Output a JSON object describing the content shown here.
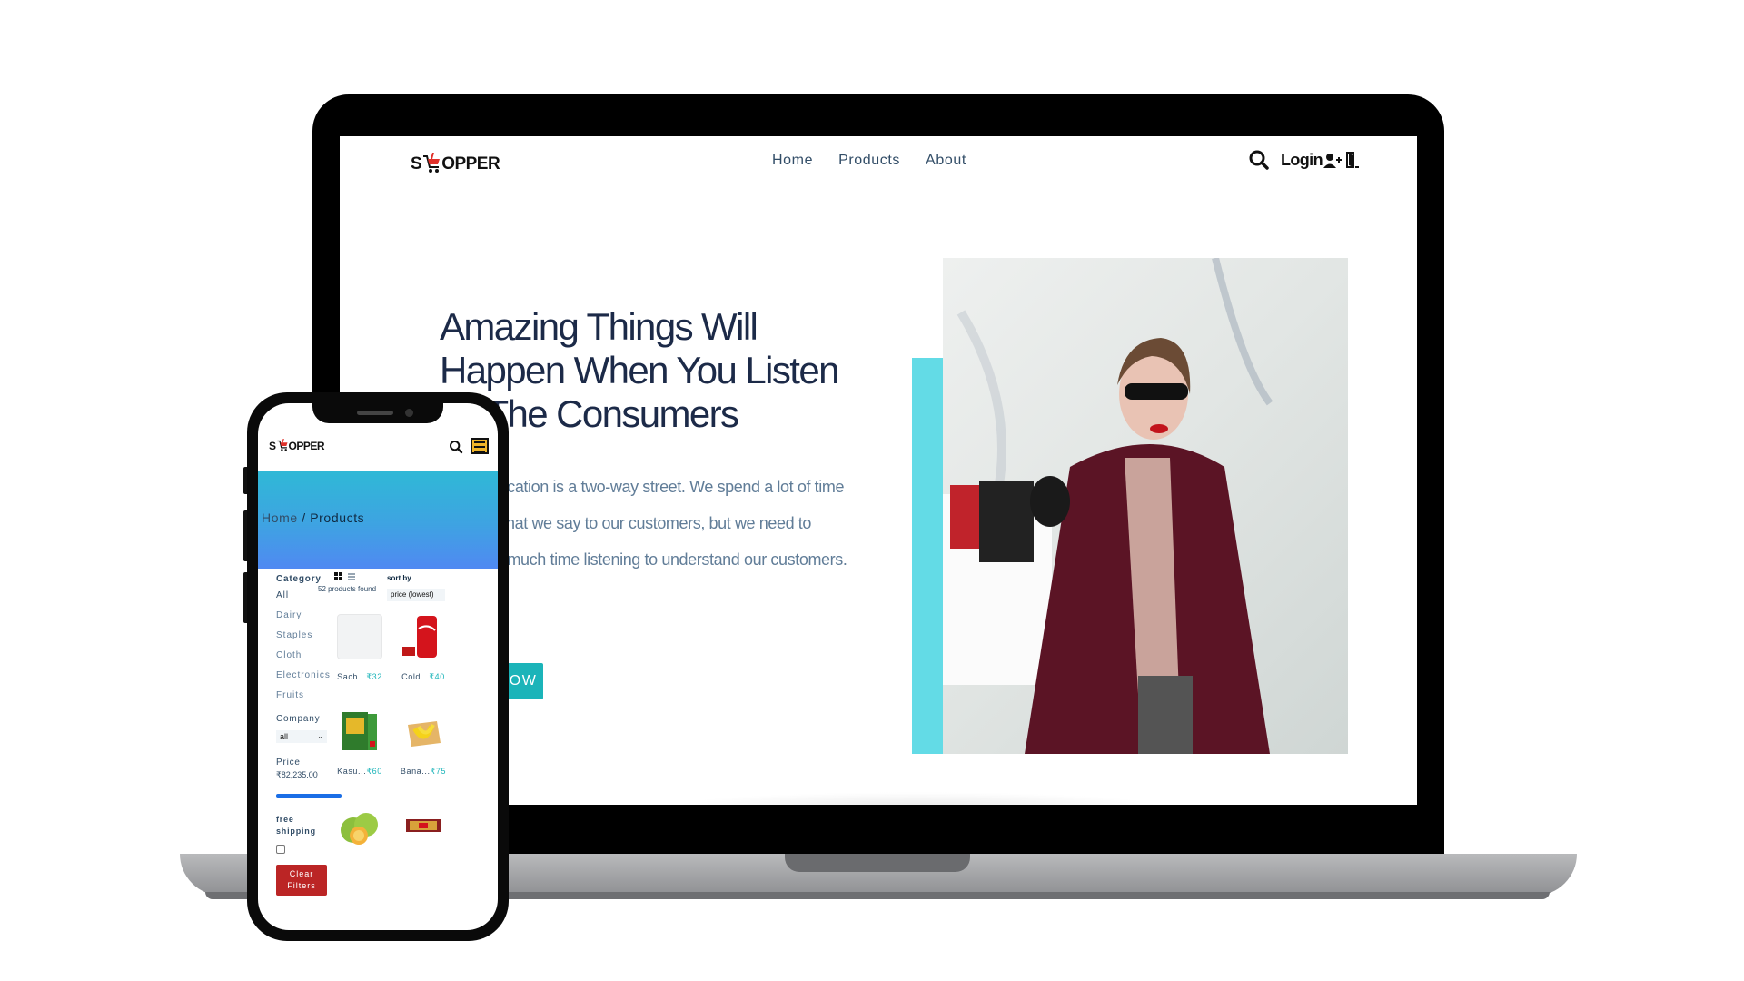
{
  "laptop": {
    "nav": {
      "logo_prefix": "S",
      "logo_suffix": "OPPER",
      "links": [
        "Home",
        "Products",
        "About"
      ],
      "login_label": "Login"
    },
    "hero": {
      "title": "Amazing Things Will Happen When You Listen To The Consumers",
      "text": "Communication is a two-way street. We spend a lot of time crafting what we say to our customers, but we need to spend as much time listening to understand our customers.",
      "button_label": "SHOP NOW"
    },
    "accent_color": "#63dbe6",
    "button_color": "#1bb4b9"
  },
  "phone": {
    "logo_prefix": "S",
    "logo_suffix": "OPPER",
    "breadcrumb_home": "Home",
    "breadcrumb_sep": " / ",
    "breadcrumb_current": "Products",
    "filters": {
      "category_heading": "Category",
      "categories": [
        "All",
        "Dairy",
        "Staples",
        "Cloth",
        "Electronics",
        "Fruits"
      ],
      "company_heading": "Company",
      "company_selected": "all",
      "price_heading": "Price",
      "price_value": "₹82,235.00",
      "shipping_label": "free shipping",
      "clear_label": "Clear Filters"
    },
    "products_found": "52 products found",
    "sort_label": "sort by",
    "sort_selected": "price (lowest)",
    "products": [
      {
        "name": "Sach...",
        "price": "₹32"
      },
      {
        "name": "Cold...",
        "price": "₹40"
      },
      {
        "name": "Kasu...",
        "price": "₹60"
      },
      {
        "name": "Bana...",
        "price": "₹75"
      }
    ]
  }
}
